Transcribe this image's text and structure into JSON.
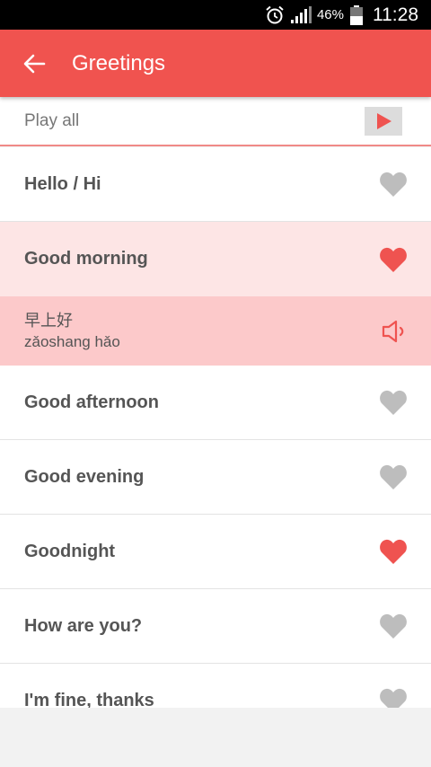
{
  "status_bar": {
    "battery_percent": "46%",
    "time": "11:28",
    "icons": [
      "alarm-icon",
      "signal-icon",
      "battery-icon"
    ]
  },
  "app_bar": {
    "title": "Greetings",
    "back_icon": "arrow-left-icon",
    "color": "#f0534f"
  },
  "play_all": {
    "label": "Play all",
    "icon": "play-icon"
  },
  "items": [
    {
      "phrase": "Hello / Hi",
      "favorite": false
    },
    {
      "phrase": "Good morning",
      "favorite": true,
      "selected": true,
      "translation": {
        "hanzi": "早上好",
        "pinyin": "zǎoshang hǎo",
        "icon": "speaker-icon"
      }
    },
    {
      "phrase": "Good afternoon",
      "favorite": false
    },
    {
      "phrase": "Good evening",
      "favorite": false
    },
    {
      "phrase": "Goodnight",
      "favorite": true
    },
    {
      "phrase": "How are you?",
      "favorite": false
    },
    {
      "phrase": "I'm fine, thanks",
      "favorite": false
    }
  ],
  "colors": {
    "accent": "#f0534f",
    "favorite_on": "#ef5350",
    "favorite_off": "#bdbdbd",
    "selected_row": "#fde5e5",
    "detail_row": "#fcc9ca"
  }
}
